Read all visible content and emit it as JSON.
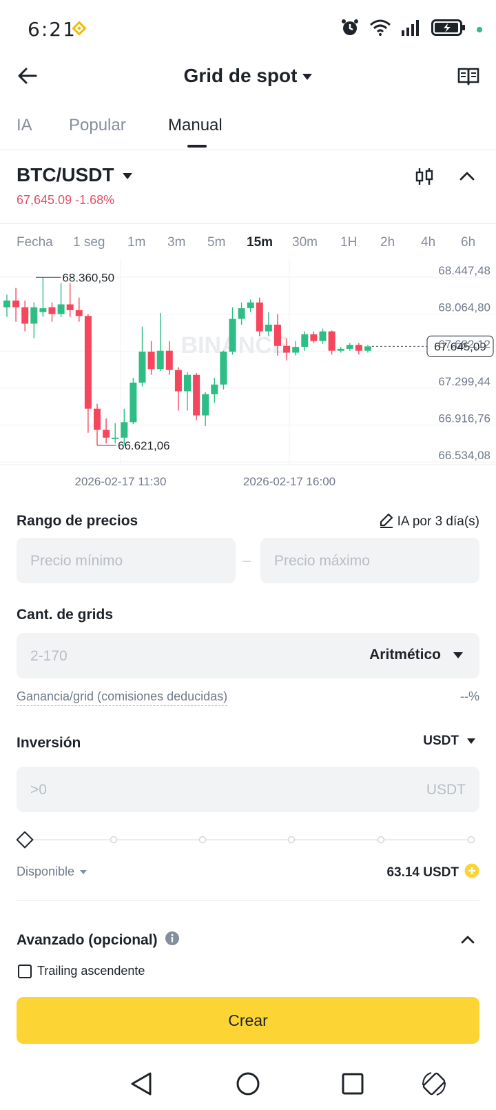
{
  "status_bar": {
    "time": "6:21",
    "icons": [
      "bnb-icon",
      "alarm-icon",
      "wifi-icon",
      "signal-icon",
      "battery-charging-icon"
    ]
  },
  "header": {
    "title": "Grid de spot",
    "back_icon": "arrow-left-icon",
    "guide_icon": "book-icon"
  },
  "tabs": [
    {
      "label": "IA"
    },
    {
      "label": "Popular"
    },
    {
      "label": "Manual"
    }
  ],
  "pair": {
    "symbol": "BTC/USDT",
    "price_change": "67,645.09 -1.68%"
  },
  "intervals": [
    "Fecha",
    "1 seg",
    "1m",
    "3m",
    "5m",
    "15m",
    "30m",
    "1H",
    "2h",
    "4h",
    "6h"
  ],
  "active_interval": "15m",
  "chart": {
    "watermark": "BINANCE",
    "y_axis": [
      "68.447,48",
      "68.064,80",
      "67.682,12",
      "67.299,44",
      "66.916,76",
      "66.534,08"
    ],
    "current_price": "67.645,09",
    "high_marker": "68.360,50",
    "low_marker": "66.621,06",
    "x_axis": [
      "2026-02-17 11:30",
      "2026-02-17 16:00"
    ]
  },
  "chart_data": {
    "type": "candlestick",
    "ylim": [
      66534.08,
      68447.48
    ],
    "y_ticks": [
      68447.48,
      68064.8,
      67682.12,
      67299.44,
      66916.76,
      66534.08
    ],
    "x_labels": [
      "2026-02-17 11:30",
      "2026-02-17 16:00"
    ],
    "last_price": 67645.09,
    "high": 68360.5,
    "low": 66621.06,
    "candles": [
      {
        "o": 68050,
        "c": 68120,
        "h": 68180,
        "l": 67950
      },
      {
        "o": 68120,
        "c": 68050,
        "h": 68250,
        "l": 67900
      },
      {
        "o": 68050,
        "c": 67880,
        "h": 68120,
        "l": 67800
      },
      {
        "o": 67880,
        "c": 68050,
        "h": 68100,
        "l": 67730
      },
      {
        "o": 68000,
        "c": 68040,
        "h": 68360,
        "l": 67950
      },
      {
        "o": 68050,
        "c": 67980,
        "h": 68100,
        "l": 67900
      },
      {
        "o": 67980,
        "c": 68080,
        "h": 68300,
        "l": 67950
      },
      {
        "o": 68080,
        "c": 68020,
        "h": 68300,
        "l": 67950
      },
      {
        "o": 68020,
        "c": 67960,
        "h": 68150,
        "l": 67900
      },
      {
        "o": 67960,
        "c": 67000,
        "h": 67980,
        "l": 66750
      },
      {
        "o": 67000,
        "c": 66780,
        "h": 67050,
        "l": 66620
      },
      {
        "o": 66780,
        "c": 66700,
        "h": 66900,
        "l": 66640
      },
      {
        "o": 66700,
        "c": 66700,
        "h": 66850,
        "l": 66640
      },
      {
        "o": 66700,
        "c": 66860,
        "h": 67000,
        "l": 66621
      },
      {
        "o": 66860,
        "c": 67270,
        "h": 67320,
        "l": 66840
      },
      {
        "o": 67270,
        "c": 67590,
        "h": 67850,
        "l": 67230
      },
      {
        "o": 67590,
        "c": 67410,
        "h": 67700,
        "l": 67350
      },
      {
        "o": 67410,
        "c": 67600,
        "h": 67990,
        "l": 67390
      },
      {
        "o": 67600,
        "c": 67400,
        "h": 67700,
        "l": 67350
      },
      {
        "o": 67400,
        "c": 67180,
        "h": 67430,
        "l": 66980
      },
      {
        "o": 67180,
        "c": 67350,
        "h": 67380,
        "l": 66980
      },
      {
        "o": 67350,
        "c": 66930,
        "h": 67370,
        "l": 66880
      },
      {
        "o": 66930,
        "c": 67150,
        "h": 67170,
        "l": 66820
      },
      {
        "o": 67150,
        "c": 67250,
        "h": 67320,
        "l": 67060
      },
      {
        "o": 67250,
        "c": 67590,
        "h": 67600,
        "l": 67200
      },
      {
        "o": 67590,
        "c": 67930,
        "h": 68050,
        "l": 67560
      },
      {
        "o": 67930,
        "c": 68040,
        "h": 68100,
        "l": 67870
      },
      {
        "o": 68040,
        "c": 68100,
        "h": 68130,
        "l": 68000
      },
      {
        "o": 68100,
        "c": 67800,
        "h": 68150,
        "l": 67750
      },
      {
        "o": 67800,
        "c": 67870,
        "h": 68000,
        "l": 67750
      },
      {
        "o": 67870,
        "c": 67650,
        "h": 67980,
        "l": 67550
      },
      {
        "o": 67650,
        "c": 67580,
        "h": 67730,
        "l": 67500
      },
      {
        "o": 67580,
        "c": 67640,
        "h": 67700,
        "l": 67550
      },
      {
        "o": 67640,
        "c": 67770,
        "h": 67800,
        "l": 67600
      },
      {
        "o": 67770,
        "c": 67700,
        "h": 67800,
        "l": 67680
      },
      {
        "o": 67700,
        "c": 67800,
        "h": 67830,
        "l": 67670
      },
      {
        "o": 67800,
        "c": 67600,
        "h": 67810,
        "l": 67560
      },
      {
        "o": 67600,
        "c": 67620,
        "h": 67640,
        "l": 67580
      },
      {
        "o": 67620,
        "c": 67660,
        "h": 67680,
        "l": 67600
      },
      {
        "o": 67660,
        "c": 67600,
        "h": 67680,
        "l": 67560
      },
      {
        "o": 67600,
        "c": 67645,
        "h": 67660,
        "l": 67580
      }
    ]
  },
  "price_range": {
    "label": "Rango de precios",
    "ai_label": "IA por 3 día(s)",
    "min_placeholder": "Precio mínimo",
    "max_placeholder": "Precio máximo",
    "separator": "–"
  },
  "grids": {
    "label": "Cant. de grids",
    "placeholder": "2-170",
    "mode": "Aritmético",
    "profit_label": "Ganancia/grid (comisiones deducidas)",
    "profit_value": "--%"
  },
  "investment": {
    "label": "Inversión",
    "currency_selector": "USDT",
    "placeholder": ">0",
    "unit": "USDT",
    "slider_percent": 0,
    "available_label": "Disponible",
    "available_value": "63.14 USDT"
  },
  "advanced": {
    "label": "Avanzado (opcional)",
    "trailing_label": "Trailing ascendente",
    "trailing_checked": false
  },
  "create_label": "Crear",
  "colors": {
    "up": "#2ebd85",
    "down": "#f6465d",
    "accent": "#fcd535",
    "negative_text": "#e14f66"
  }
}
